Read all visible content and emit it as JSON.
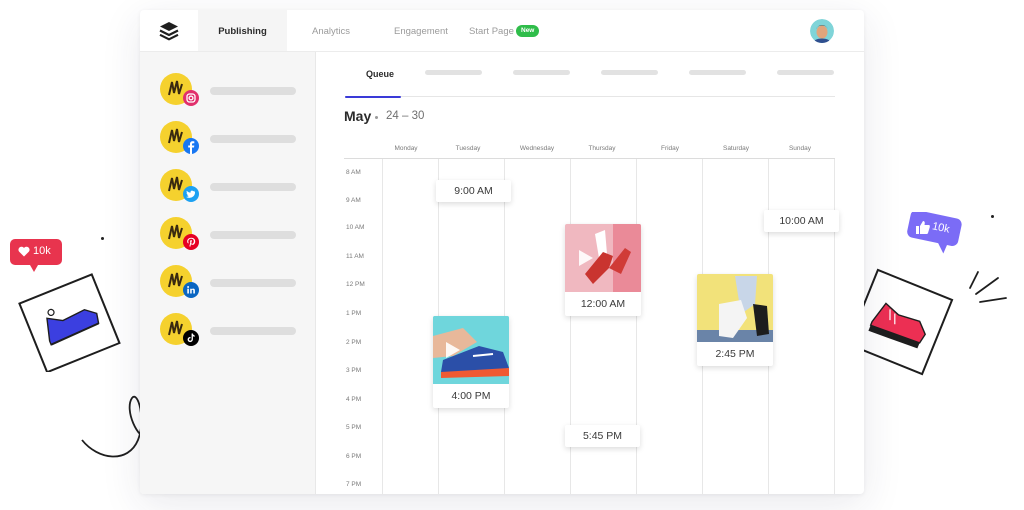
{
  "nav": {
    "tabs": [
      {
        "label": "Publishing",
        "active": true
      },
      {
        "label": "Analytics"
      },
      {
        "label": "Engagement"
      },
      {
        "label": "Start Page",
        "badge": "New"
      }
    ]
  },
  "sidebar": {
    "accounts": [
      {
        "network": "instagram",
        "icon": "instagram-icon",
        "color": "#e1306c"
      },
      {
        "network": "facebook",
        "icon": "facebook-icon",
        "color": "#1877f2"
      },
      {
        "network": "twitter",
        "icon": "twitter-icon",
        "color": "#1da1f2"
      },
      {
        "network": "pinterest",
        "icon": "pinterest-icon",
        "color": "#e60023"
      },
      {
        "network": "linkedin",
        "icon": "linkedin-icon",
        "color": "#0a66c2"
      },
      {
        "network": "tiktok",
        "icon": "tiktok-icon",
        "color": "#000000"
      }
    ]
  },
  "queue": {
    "tab_label": "Queue",
    "month": "May",
    "range": "24 – 30",
    "days": [
      "Monday",
      "Tuesday",
      "Wednesday",
      "Thursday",
      "Friday",
      "Saturday",
      "Sunday"
    ],
    "times": [
      "8 AM",
      "9 AM",
      "10 AM",
      "11 AM",
      "12 PM",
      "1 PM",
      "2 PM",
      "3 PM",
      "4 PM",
      "5 PM",
      "6 PM",
      "7 PM"
    ],
    "posts": [
      {
        "time": "9:00 AM",
        "day": "Tuesday",
        "media": "none"
      },
      {
        "time": "4:00 PM",
        "day": "Monday",
        "media": "video"
      },
      {
        "time": "12:00 AM",
        "day": "Thursday",
        "media": "video"
      },
      {
        "time": "5:45 PM",
        "day": "Thursday",
        "media": "none"
      },
      {
        "time": "2:45 PM",
        "day": "Saturday",
        "media": "image"
      },
      {
        "time": "10:00 AM",
        "day": "Sunday",
        "media": "none"
      }
    ]
  },
  "decorations": {
    "likes_badge": {
      "icon": "heart-icon",
      "count": "10k",
      "color": "#e8344e"
    },
    "thumbs_badge": {
      "icon": "thumbs-up-icon",
      "count": "10k",
      "color": "#7b6cf6"
    }
  },
  "colors": {
    "accent": "#3a3ad8",
    "new_badge": "#2fbd4a"
  }
}
